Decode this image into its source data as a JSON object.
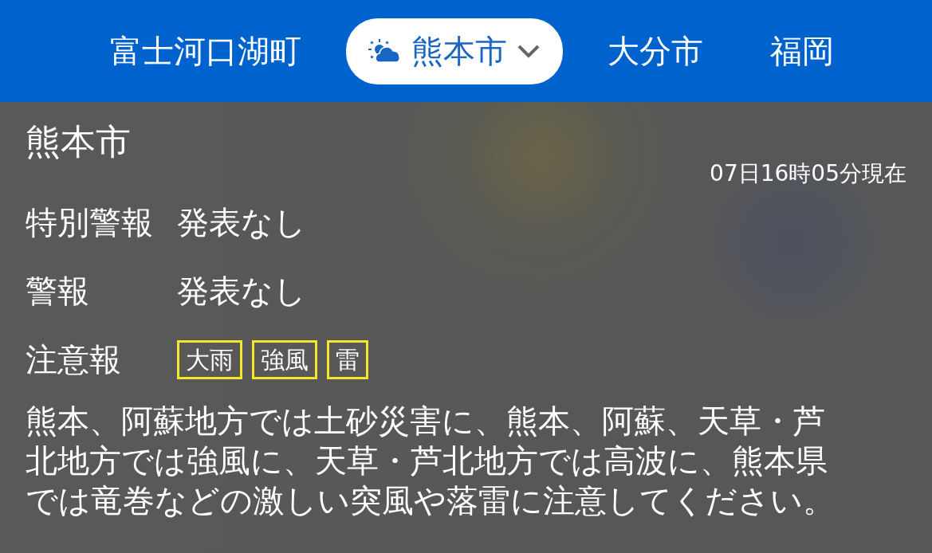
{
  "tabs": [
    {
      "label": "富士河口湖町",
      "selected": false
    },
    {
      "label": "熊本市",
      "selected": true
    },
    {
      "label": "大分市",
      "selected": false
    },
    {
      "label": "福岡",
      "selected": false
    }
  ],
  "city": "熊本市",
  "updated": "07日16時05分現在",
  "rows": [
    {
      "label": "特別警報",
      "value": "発表なし"
    },
    {
      "label": "警報",
      "value": "発表なし"
    },
    {
      "label": "注意報",
      "badges": [
        "大雨",
        "強風",
        "雷"
      ]
    }
  ],
  "message": "熊本、阿蘇地方では土砂災害に、熊本、阿蘇、天草・芦北地方では強風に、天草・芦北地方では高波に、熊本県では竜巻などの激しい突風や落雷に注意してください。"
}
